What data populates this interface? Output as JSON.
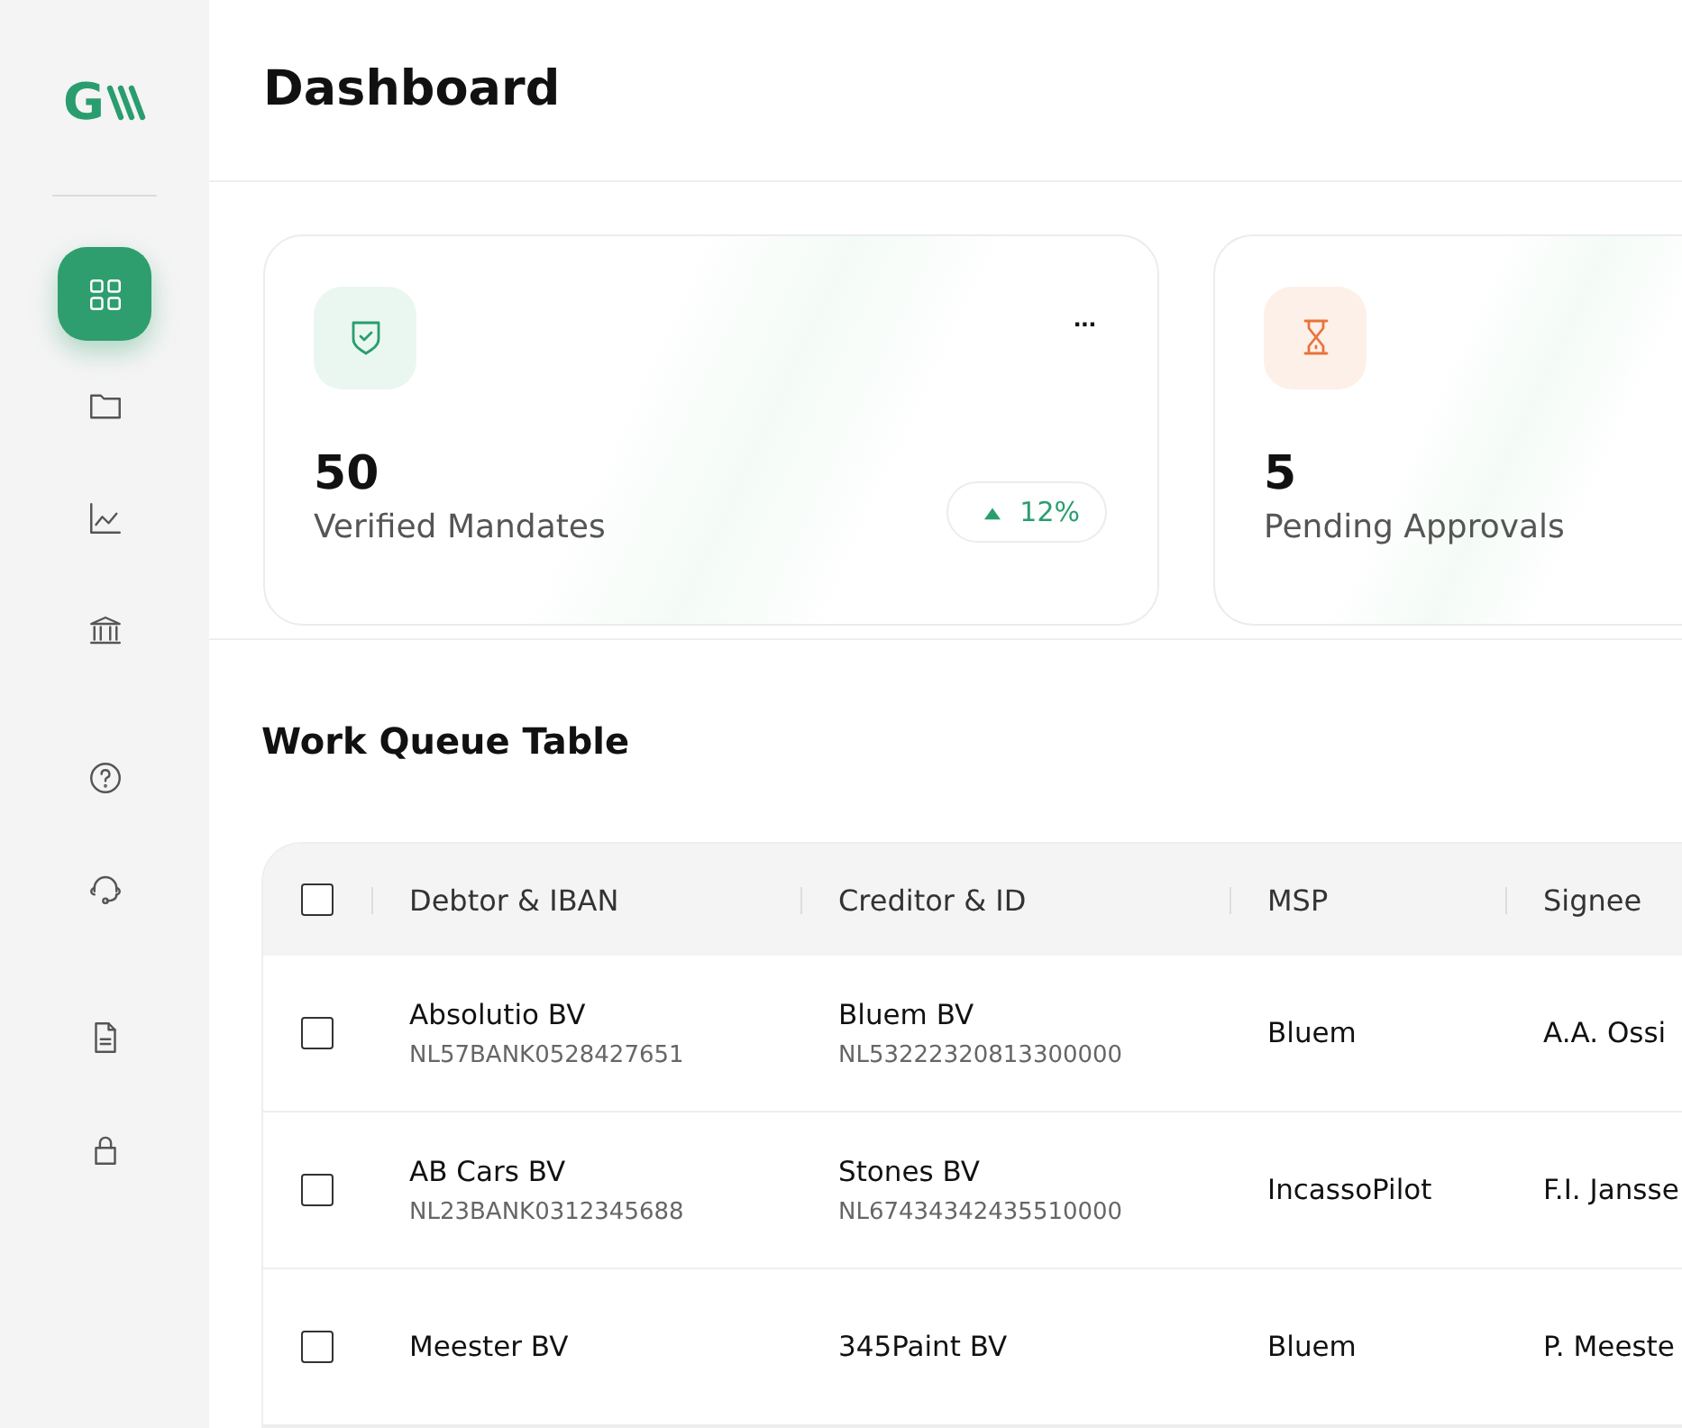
{
  "logo": {
    "text": "G"
  },
  "sidebar": {
    "items": [
      {
        "kind": "grid",
        "selected": true
      },
      {
        "kind": "folder",
        "selected": false
      },
      {
        "kind": "chart",
        "selected": false
      },
      {
        "kind": "bank",
        "selected": false
      },
      {
        "kind": "help",
        "selected": false
      },
      {
        "kind": "headset",
        "selected": false
      },
      {
        "kind": "document",
        "selected": false
      },
      {
        "kind": "lock",
        "selected": false
      }
    ]
  },
  "header": {
    "title": "Dashboard"
  },
  "stats": [
    {
      "kind": "verified",
      "value": "50",
      "label": "Verified Mandates",
      "menu": "...",
      "trend": "12%"
    },
    {
      "kind": "pending",
      "value": "5",
      "label": "Pending Approvals"
    }
  ],
  "work_queue": {
    "title": "Work Queue Table",
    "columns": [
      "Debtor & IBAN",
      "Creditor & ID",
      "MSP",
      "Signee"
    ],
    "header_checked": false,
    "rows": [
      {
        "checked": false,
        "debtor": "Absolutio BV",
        "debtor_iban": "NL57BANK0528427651",
        "creditor": "Bluem BV",
        "creditor_id": "NL53222320813300000",
        "msp": "Bluem",
        "signee": "A.A. Ossi"
      },
      {
        "checked": false,
        "debtor": "AB Cars BV",
        "debtor_iban": "NL23BANK0312345688",
        "creditor": "Stones BV",
        "creditor_id": "NL67434342435510000",
        "msp": "IncassoPilot",
        "signee": "F.I. Jansse"
      },
      {
        "checked": false,
        "debtor": "Meester BV",
        "creditor": "345Paint BV",
        "msp": "Bluem",
        "signee": "P. Meeste"
      }
    ]
  }
}
